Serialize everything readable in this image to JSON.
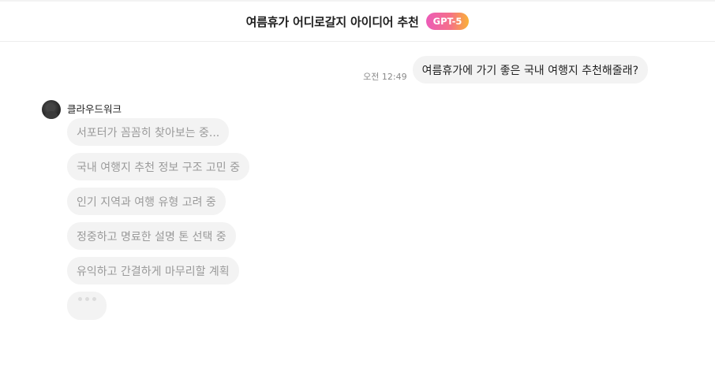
{
  "header": {
    "title": "여름휴가 어디로갈지 아이디어 추천",
    "model_badge": "GPT-5"
  },
  "user_message": {
    "time": "오전 12:49",
    "text": "여름휴가에 가기 좋은 국내 여행지 추천해줄래?"
  },
  "assistant": {
    "name": "클라우드워크",
    "status_steps": [
      "서포터가 꼼꼼히 찾아보는 중...",
      "국내 여행지 추천 정보 구조 고민 중",
      "인기 지역과 여행 유형 고려 중",
      "정중하고 명료한 설명 톤 선택 중",
      "유익하고 간결하게 마무리할 계획"
    ]
  },
  "colors": {
    "badge_gradient_start": "#ec5bb8",
    "badge_gradient_end": "#f9b136",
    "bubble_bg": "#f3f3f3",
    "status_text": "#9a9a9a"
  }
}
